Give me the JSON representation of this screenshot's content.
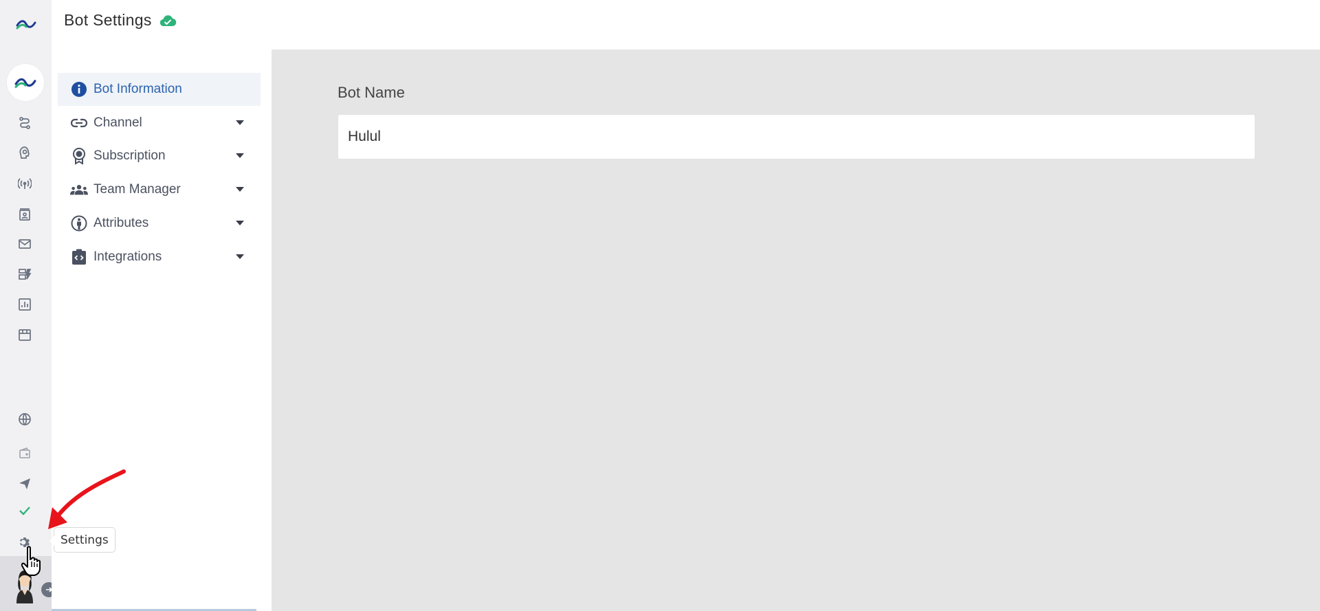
{
  "header": {
    "title": "Bot Settings",
    "sync_status_icon": "cloud-check-icon",
    "sync_color": "#2fb37a"
  },
  "rail": {
    "brand_icon": "brand-logo-icon",
    "items": [
      {
        "icon": "flow-icon"
      },
      {
        "icon": "ai-brain-icon"
      },
      {
        "icon": "broadcast-icon"
      },
      {
        "icon": "contacts-icon"
      },
      {
        "icon": "mail-icon"
      },
      {
        "icon": "templates-icon"
      },
      {
        "icon": "analytics-icon"
      },
      {
        "icon": "store-icon"
      },
      {
        "icon": "globe-icon"
      },
      {
        "icon": "wallet-icon"
      },
      {
        "icon": "send-icon"
      },
      {
        "icon": "check-icon"
      },
      {
        "icon": "gear-icon"
      }
    ]
  },
  "settings_menu": {
    "items": [
      {
        "label": "Bot Information",
        "icon": "info-icon",
        "active": true
      },
      {
        "label": "Channel",
        "icon": "link-icon"
      },
      {
        "label": "Subscription",
        "icon": "badge-icon"
      },
      {
        "label": "Team Manager",
        "icon": "team-icon"
      },
      {
        "label": "Attributes",
        "icon": "person-icon"
      },
      {
        "label": "Integrations",
        "icon": "code-icon"
      }
    ],
    "active_color": "#2b63b0"
  },
  "main": {
    "bot_name_label": "Bot Name",
    "bot_name_value": "Hulul"
  },
  "tooltip": {
    "text": "Settings"
  },
  "annotation": {
    "arrow_color": "#e8141b"
  }
}
